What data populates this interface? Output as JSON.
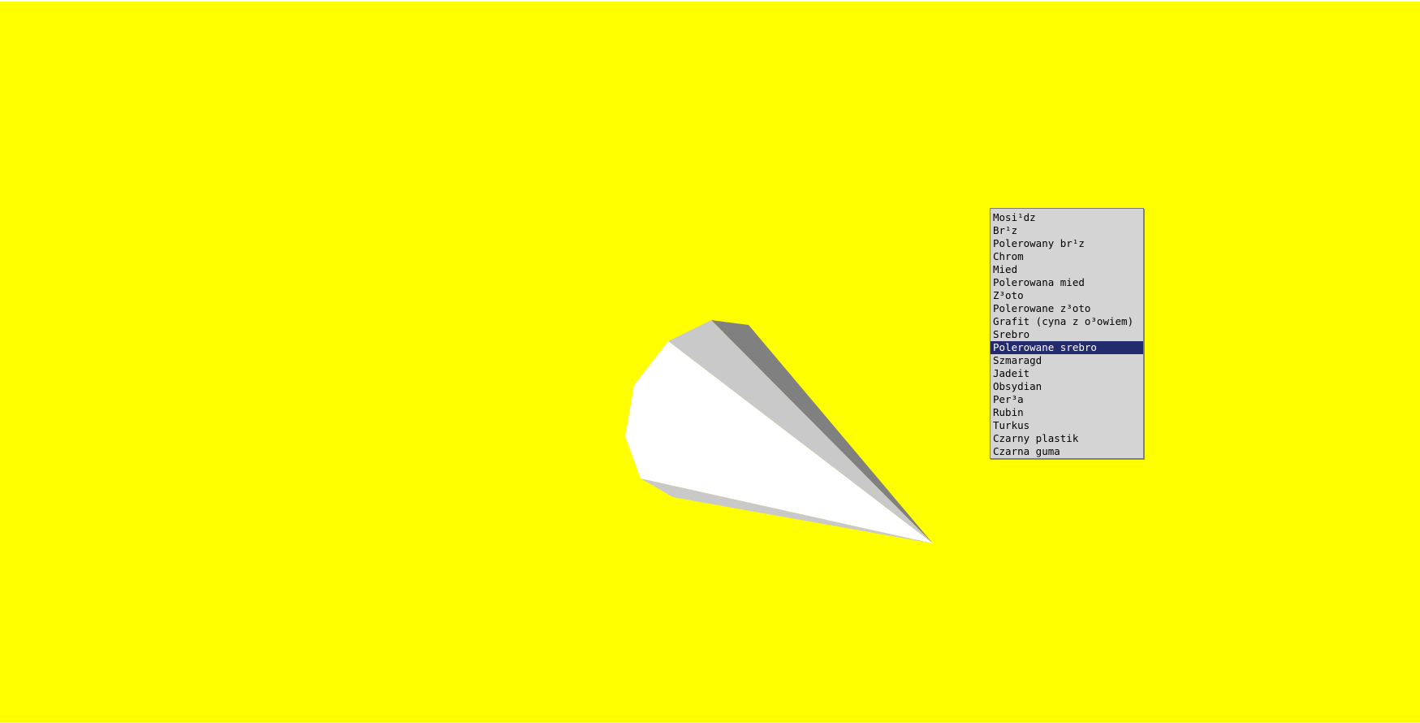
{
  "colors": {
    "background": "#ffff00",
    "menu_background": "#d4d4d4",
    "menu_selection": "#242a6e",
    "menu_text": "#000000",
    "selected_text": "#ffffff",
    "object_light": "#ffffff",
    "object_mid": "#c9c9c9",
    "object_dark": "#808080"
  },
  "scene": {
    "object_icon": "cone-shape"
  },
  "material_menu": {
    "selected_index": 10,
    "items": [
      {
        "label": "Mosi¹dz"
      },
      {
        "label": "Br¹z"
      },
      {
        "label": "Polerowany br¹z"
      },
      {
        "label": "Chrom"
      },
      {
        "label": "Mied"
      },
      {
        "label": "Polerowana mied"
      },
      {
        "label": "Z³oto"
      },
      {
        "label": "Polerowane z³oto"
      },
      {
        "label": "Grafit (cyna z o³owiem)"
      },
      {
        "label": "Srebro"
      },
      {
        "label": "Polerowane srebro"
      },
      {
        "label": "Szmaragd"
      },
      {
        "label": "Jadeit"
      },
      {
        "label": "Obsydian"
      },
      {
        "label": "Per³a"
      },
      {
        "label": "Rubin"
      },
      {
        "label": "Turkus"
      },
      {
        "label": "Czarny plastik"
      },
      {
        "label": "Czarna guma"
      }
    ]
  }
}
